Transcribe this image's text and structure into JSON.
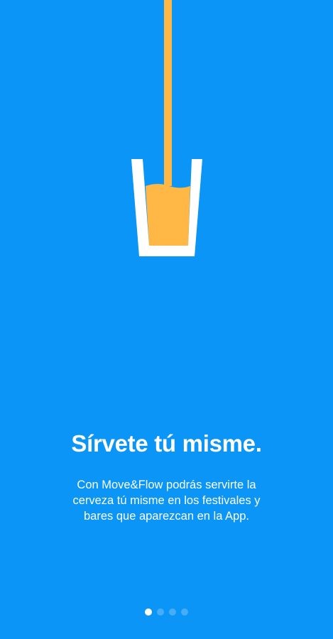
{
  "onboarding": {
    "title": "Sírvete tú misme.",
    "description": "Con Move&Flow podrás servirte la cerveza tú misme en los festivales y bares que aparezcan en la App.",
    "illustration_icon": "beer-glass-pour-icon"
  },
  "pager": {
    "total_pages": 4,
    "current_page": 1
  },
  "colors": {
    "background": "#0b95f6",
    "beer": "#ffb845",
    "glass": "#ffffff",
    "dot_inactive": "#46aef9",
    "dot_active": "#ffffff"
  }
}
